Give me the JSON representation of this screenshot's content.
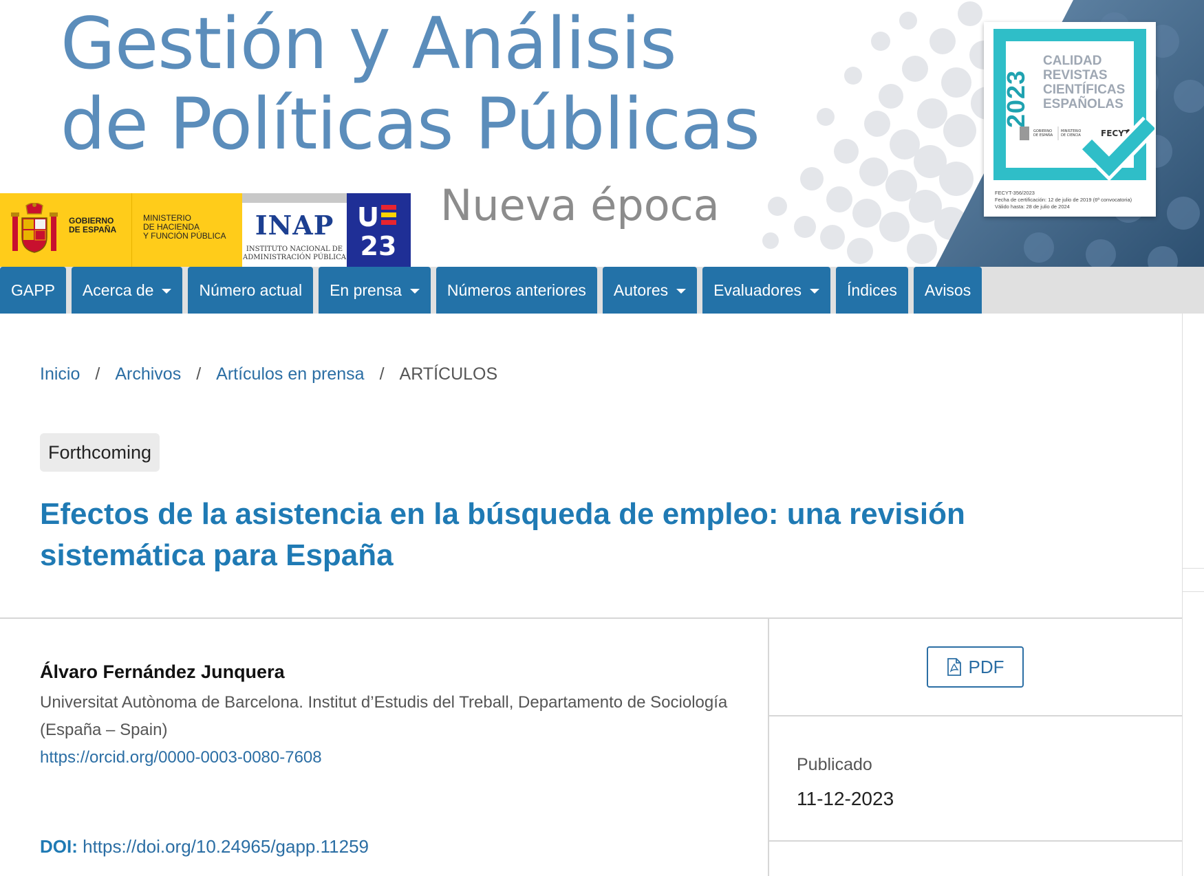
{
  "banner": {
    "title_line1": "Gestión y Análisis",
    "title_line2": "de Políticas Públicas",
    "subtitle": "Nueva época",
    "logos": {
      "gobierno": "GOBIERNO\nDE ESPAÑA",
      "ministerio": "MINISTERIO\nDE HACIENDA\nY FUNCIÓN PÚBLICA",
      "inap_title": "INAP",
      "inap_sub": "INSTITUTO NACIONAL DE\nADMINISTRACIÓN PÚBLICA",
      "ue_line1": "UE",
      "ue_line2": "23"
    },
    "fecyt": {
      "year": "2023",
      "text": "CALIDAD\nREVISTAS\nCIENTÍFICAS\nESPAÑOLAS",
      "gob_small": "GOBIERNO DE ESPAÑA",
      "min_small": "MINISTERIO DE CIENCIA E INNOVACIÓN",
      "fecyt_small": "FECYT",
      "footer": "FECYT-356/2023\nFecha de certificación: 12 de julio de 2019 (6ª convocatoria)\nVálido hasta: 28 de julio de 2024"
    }
  },
  "nav": {
    "items": [
      {
        "label": "GAPP",
        "dropdown": false
      },
      {
        "label": "Acerca de",
        "dropdown": true
      },
      {
        "label": "Número actual",
        "dropdown": false
      },
      {
        "label": "En prensa",
        "dropdown": true
      },
      {
        "label": "Números anteriores",
        "dropdown": false
      },
      {
        "label": "Autores",
        "dropdown": true
      },
      {
        "label": "Evaluadores",
        "dropdown": true
      },
      {
        "label": "Índices",
        "dropdown": false
      },
      {
        "label": "Avisos",
        "dropdown": false
      }
    ]
  },
  "breadcrumb": {
    "items": [
      "Inicio",
      "Archivos",
      "Artículos en prensa"
    ],
    "current": "ARTÍCULOS",
    "separator": "/"
  },
  "article": {
    "badge": "Forthcoming",
    "title": "Efectos de la asistencia en la búsqueda de empleo: una revisión sistemática para España",
    "author": "Álvaro Fernández Junquera",
    "affiliation": "Universitat Autònoma de Barcelona. Institut d’Estudis del Treball, Departamento de Sociología (España – Spain)",
    "orcid": "https://orcid.org/0000-0003-0080-7608",
    "doi_label": "DOI:",
    "doi": "https://doi.org/10.24965/gapp.11259"
  },
  "sidebar": {
    "pdf_label": "PDF",
    "published_label": "Publicado",
    "published_date": "11-12-2023"
  },
  "colors": {
    "nav_bg": "#2372a8",
    "title_blue": "#1f7ab4",
    "link_blue": "#2b6ea4",
    "banner_blue": "#5b8dbb",
    "gob_yellow": "#ffcc1a",
    "fecyt_teal": "#2fbec8"
  }
}
